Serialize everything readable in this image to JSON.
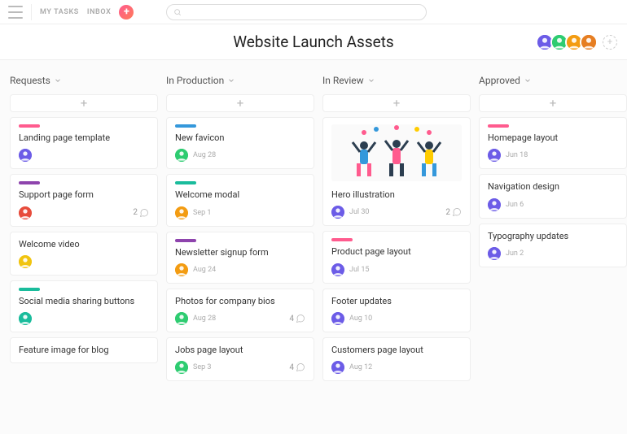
{
  "nav": {
    "my_tasks": "MY TASKS",
    "inbox": "INBOX"
  },
  "search": {
    "placeholder": ""
  },
  "title": "Website Launch Assets",
  "members": [
    {
      "bg": "#6c5ce7"
    },
    {
      "bg": "#2ecc71"
    },
    {
      "bg": "#f39c12"
    },
    {
      "bg": "#e67e22"
    }
  ],
  "columns": [
    {
      "name": "Requests",
      "cards": [
        {
          "title": "Landing page template",
          "tag": "#ff5b8e",
          "avatar": "#6c5ce7",
          "date": "",
          "comments": null
        },
        {
          "title": "Support page form",
          "tag": "#8e44ad",
          "avatar": "#e74c3c",
          "date": "",
          "comments": 2
        },
        {
          "title": "Welcome video",
          "tag": null,
          "avatar": "#f1c40f",
          "date": "",
          "comments": null
        },
        {
          "title": "Social media sharing buttons",
          "tag": "#1abc9c",
          "avatar": "#1abc9c",
          "date": "",
          "comments": null
        },
        {
          "title": "Feature image for blog",
          "tag": null,
          "avatar": null,
          "date": "",
          "comments": null
        }
      ]
    },
    {
      "name": "In Production",
      "cards": [
        {
          "title": "New favicon",
          "tag": "#3498db",
          "avatar": "#2ecc71",
          "date": "Aug 28",
          "comments": null
        },
        {
          "title": "Welcome modal",
          "tag": "#1abc9c",
          "avatar": "#f39c12",
          "date": "Sep 1",
          "comments": null
        },
        {
          "title": "Newsletter signup form",
          "tag": "#8e44ad",
          "avatar": "#f39c12",
          "date": "Aug 24",
          "comments": null
        },
        {
          "title": "Photos for company bios",
          "tag": null,
          "avatar": "#2ecc71",
          "date": "Aug 28",
          "comments": 4
        },
        {
          "title": "Jobs page layout",
          "tag": null,
          "avatar": "#2ecc71",
          "date": "Sep 3",
          "comments": 4
        }
      ]
    },
    {
      "name": "In Review",
      "cards": [
        {
          "title": "Hero illustration",
          "tag": null,
          "avatar": "#6c5ce7",
          "date": "Jul 30",
          "comments": 2,
          "hero": true
        },
        {
          "title": "Product page layout",
          "tag": "#ff5b8e",
          "avatar": "#6c5ce7",
          "date": "Jul 15",
          "comments": null
        },
        {
          "title": "Footer updates",
          "tag": null,
          "avatar": "#6c5ce7",
          "date": "Aug 10",
          "comments": null
        },
        {
          "title": "Customers page layout",
          "tag": null,
          "avatar": "#6c5ce7",
          "date": "Aug 12",
          "comments": null
        }
      ]
    },
    {
      "name": "Approved",
      "cards": [
        {
          "title": "Homepage layout",
          "tag": "#ff5b8e",
          "avatar": "#6c5ce7",
          "date": "Jun 18",
          "comments": null
        },
        {
          "title": "Navigation design",
          "tag": null,
          "avatar": "#6c5ce7",
          "date": "Jun 6",
          "comments": null
        },
        {
          "title": "Typography updates",
          "tag": null,
          "avatar": "#6c5ce7",
          "date": "Jun 2",
          "comments": null
        }
      ]
    }
  ]
}
